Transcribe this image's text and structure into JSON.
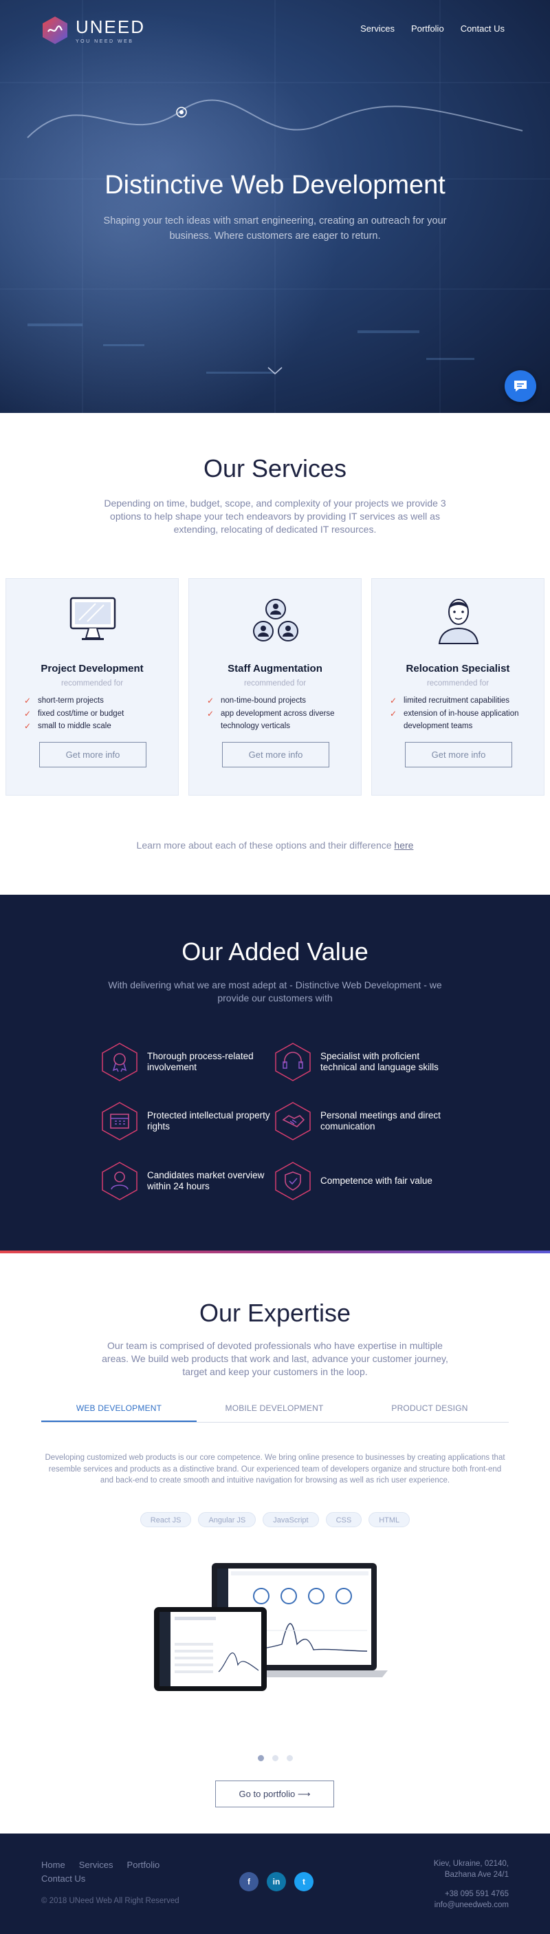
{
  "brand": {
    "name": "UNEED",
    "tagline": "YOU NEED WEB"
  },
  "nav": [
    "Services",
    "Portfolio",
    "Contact Us"
  ],
  "hero": {
    "title": "Distinctive Web Development",
    "subtitle": "Shaping your tech ideas with smart engineering, creating an outreach for your business. Where customers are eager to return."
  },
  "services": {
    "title": "Our Services",
    "subtitle": "Depending on time, budget, scope, and complexity of your projects we provide 3 options to help shape your tech endeavors by providing IT services as well as extending, relocating of dedicated IT resources.",
    "cards": [
      {
        "title": "Project Development",
        "rec": "recommended for",
        "items": [
          "short-term projects",
          "fixed cost/time or budget",
          "small to middle scale"
        ],
        "button": "Get more info",
        "icon": "monitor-icon"
      },
      {
        "title": "Staff Augmentation",
        "rec": "recommended for",
        "items": [
          "non-time-bound projects",
          "app development across diverse technology verticals"
        ],
        "button": "Get more info",
        "icon": "team-icon"
      },
      {
        "title": "Relocation Specialist",
        "rec": "recommended for",
        "items": [
          "limited recruitment capabilities",
          "extension of in-house application development teams"
        ],
        "button": "Get more info",
        "icon": "person-icon"
      }
    ],
    "learn_text": "Learn more about each of these options and their difference ",
    "learn_link": "here"
  },
  "value": {
    "title": "Our Added Value",
    "subtitle": "With delivering what we are most adept at - Distinctive Web Development - we provide our customers with",
    "items": [
      {
        "label": "Thorough process-related involvement",
        "icon": "award-icon"
      },
      {
        "label": "Specialist with proficient technical and language skills",
        "icon": "headset-icon"
      },
      {
        "label": "Protected intellectual property rights",
        "icon": "calendar-icon"
      },
      {
        "label": "Personal meetings and direct comunication",
        "icon": "handshake-icon"
      },
      {
        "label": "Candidates market overview within 24 hours",
        "icon": "candidate-icon"
      },
      {
        "label": "Competence with fair value",
        "icon": "shield-icon"
      }
    ]
  },
  "expertise": {
    "title": "Our Expertise",
    "subtitle": "Our team is comprised of devoted professionals who have expertise in multiple areas. We build web products that work and last, advance your customer journey, target and keep your customers in the loop.",
    "tabs": [
      "WEB DEVELOPMENT",
      "MOBILE DEVELOPMENT",
      "PRODUCT DESIGN"
    ],
    "active_tab": "WEB DEVELOPMENT",
    "description": "Developing customized web products is our core competence. We bring online presence to businesses by creating applications that resemble services and products as a distinctive brand. Our experienced team of developers organize and structure both front-end and back-end to create smooth and intuitive navigation for browsing as well as rich user experience.",
    "chips": [
      "React JS",
      "Angular JS",
      "JavaScript",
      "CSS",
      "HTML"
    ],
    "portfolio_button": "Go to portfolio"
  },
  "footer": {
    "nav": [
      "Home",
      "Services",
      "Portfolio"
    ],
    "contact": "Contact Us",
    "copyright": "© 2018 UNeed Web All Right Reserved",
    "address": [
      "Kiev, Ukraine, 02140,",
      "Bazhana Ave 24/1"
    ],
    "phone": "+38 095 591 4765",
    "email": "info@uneedweb.com",
    "social": [
      "facebook-icon",
      "linkedin-icon",
      "twitter-icon"
    ]
  },
  "colors": {
    "accent": "#2676e8",
    "dark": "#131d3c",
    "check": "#e2503c",
    "tab_active": "#2f6fc6"
  }
}
